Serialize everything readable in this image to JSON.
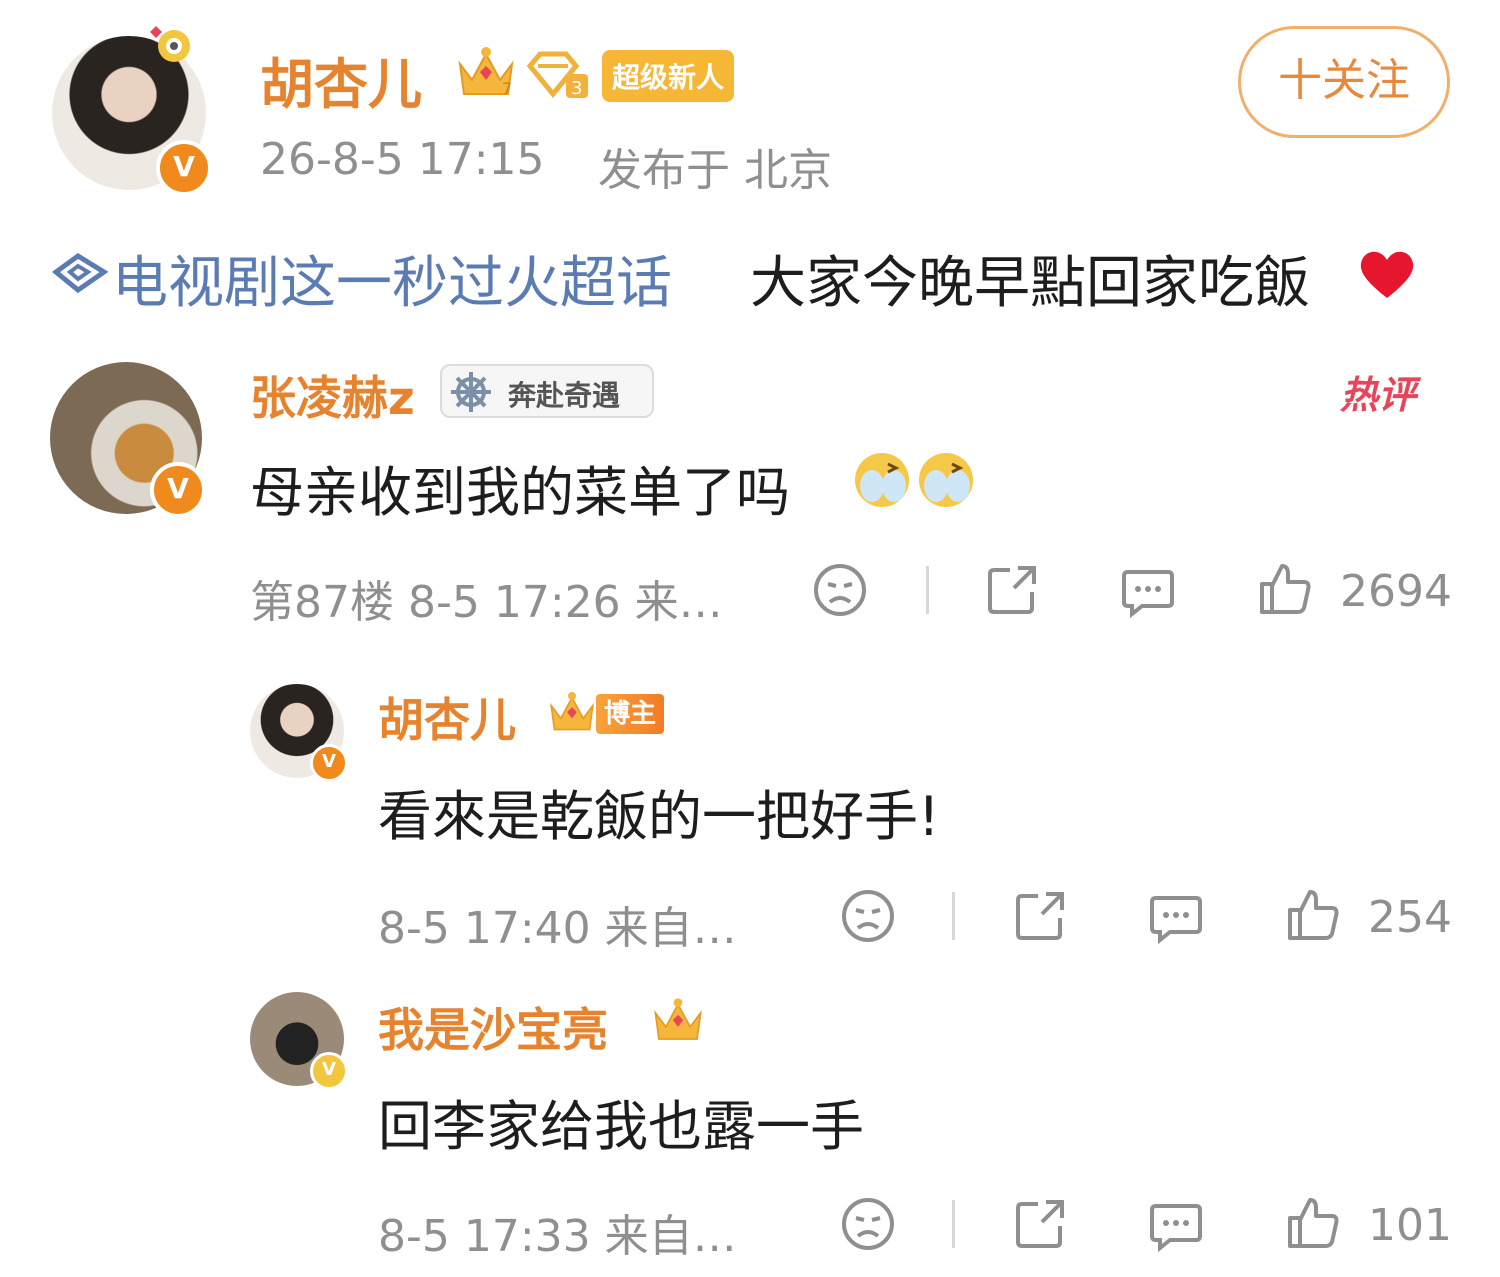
{
  "post": {
    "author_name": "胡杏儿",
    "badge_label": "超级新人",
    "follow_label": "十关注",
    "time": "26-8-5 17:15",
    "location": "发布于 北京",
    "topic": "电视剧这一秒过火超话",
    "text": "大家今晚早點回家吃飯"
  },
  "comments": [
    {
      "user": "张凌赫z",
      "badge": "奔赴奇遇",
      "hot_label": "热评",
      "text": "母亲收到我的菜单了吗",
      "meta": "第87楼 8-5 17:26 来…",
      "likes": "2694"
    },
    {
      "user": "胡杏儿",
      "role_badge": "博主",
      "text": "看來是乾飯的一把好手!",
      "meta": "8-5 17:40 来自…",
      "likes": "254"
    },
    {
      "user": "我是沙宝亮",
      "text": "回李家给我也露一手",
      "meta": "8-5 17:33 来自…",
      "likes": "101"
    }
  ],
  "colors": {
    "name_orange": "#e5832f",
    "topic_blue": "#5b7bb3",
    "meta_gray": "#8f8f8f",
    "badge_gold": "#f6b736",
    "verified_orange": "#f08a1c",
    "hot_red": "#e8455a"
  },
  "icons": [
    "crown-level-icon",
    "diamond-level-icon",
    "verified-v-icon",
    "super-topic-icon",
    "heart-emoji-icon",
    "helm-icon",
    "laugh-cry-emoji-icon",
    "dislike-face-icon",
    "share-icon",
    "comment-icon",
    "like-icon"
  ]
}
